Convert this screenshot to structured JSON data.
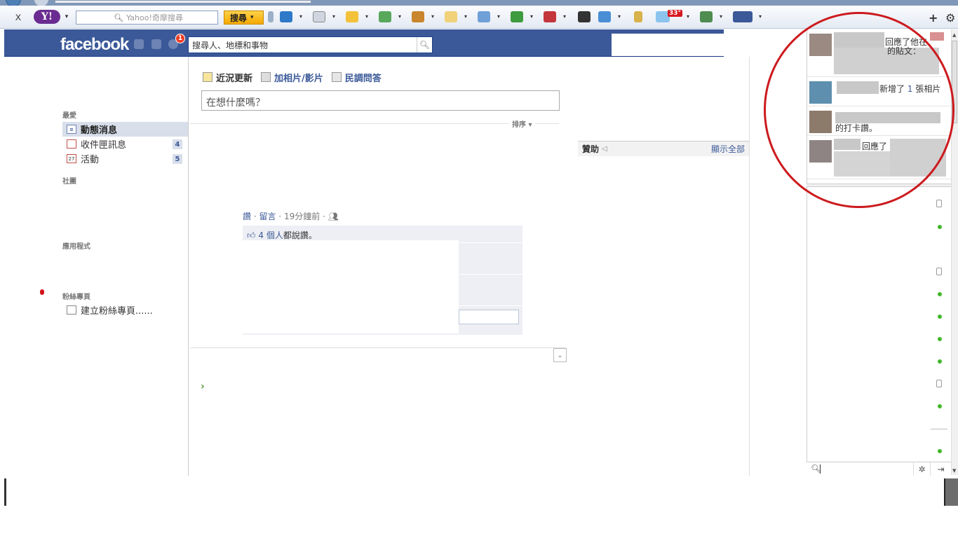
{
  "toolbar": {
    "close_label": "x",
    "search_placeholder": "Yahoo!奇摩搜尋",
    "search_button": "搜尋",
    "weather_badge": "33°",
    "plus_label": "+",
    "gear_label": "⚙"
  },
  "header": {
    "logo": "facebook",
    "notification_count": "1",
    "search_text": "搜尋人、地標和事物"
  },
  "nav": {
    "favorites_title": "最愛",
    "items": [
      {
        "label": "動態消息",
        "count": ""
      },
      {
        "label": "收件匣訊息",
        "count": "4"
      },
      {
        "label": "活動",
        "count": "5"
      }
    ],
    "events_icon_text": "27",
    "groups_title": "社團",
    "apps_title": "應用程式",
    "pages_title": "粉絲專頁",
    "create_page": "建立粉絲專頁......"
  },
  "composer": {
    "tabs": [
      "近況更新",
      "加相片/影片",
      "民調問答"
    ],
    "placeholder": "在想什麼嗎？",
    "sort_label": "排序 ▾"
  },
  "sponsored": {
    "title": "贊助",
    "show_all": "顯示全部"
  },
  "feed": {
    "like_link": "讚",
    "comment_link": "留言",
    "time": "19分鐘前",
    "likes_count_link": "4 個人",
    "likes_suffix": "都說讚。"
  },
  "ticker": {
    "items": [
      {
        "text": "回應了他在",
        "text2": "的貼文："
      },
      {
        "text": "新增了",
        "num": "1",
        "text_after": "張相片"
      },
      {
        "text": "的打卡讚。"
      },
      {
        "text": "回應了"
      }
    ]
  },
  "colors": {
    "fb_blue": "#3b5998",
    "annotation_red": "#cc1a1e",
    "online_green": "#42b72a"
  }
}
